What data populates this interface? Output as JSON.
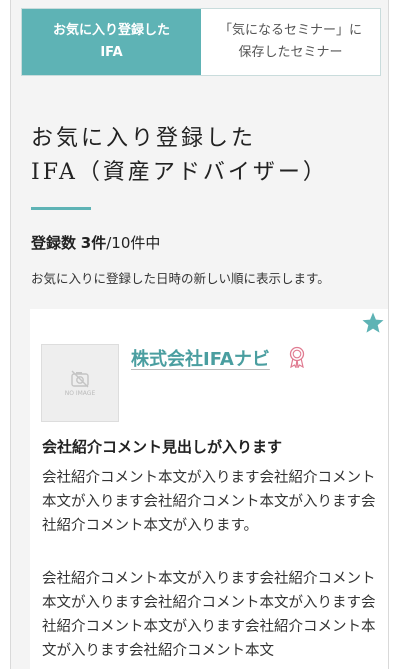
{
  "tabs": [
    {
      "label": "お気に入り登録した\nIFA",
      "active": true
    },
    {
      "label": "「気になるセミナー」に\n保存したセミナー",
      "active": false
    }
  ],
  "page": {
    "title": "お気に入り登録した\nIFA（資産アドバイザー）",
    "count_label": "登録数",
    "count_value": "3件",
    "count_total": "/10件中",
    "description": "お気に入りに登録した日時の新しい順に表示します。"
  },
  "card": {
    "favorite_icon": "star-icon",
    "thumbnail_text": "NO IMAGE",
    "company_name": "株式会社IFAナビ",
    "award_icon": "award-ribbon-icon",
    "headline": "会社紹介コメント見出しが入ります",
    "body_1": "会社紹介コメント本文が入ります会社紹介コメント本文が入ります会社紹介コメント本文が入ります会社紹介コメント本文が入ります。",
    "body_2": "会社紹介コメント本文が入ります会社紹介コメント本文が入ります会社紹介コメント本文が入ります会社紹介コメント本文が入ります会社紹介コメント本文が入ります会社紹介コメント本文"
  },
  "colors": {
    "accent": "#5eb3b5",
    "link": "#4a9ea0",
    "award": "#e07b91"
  }
}
